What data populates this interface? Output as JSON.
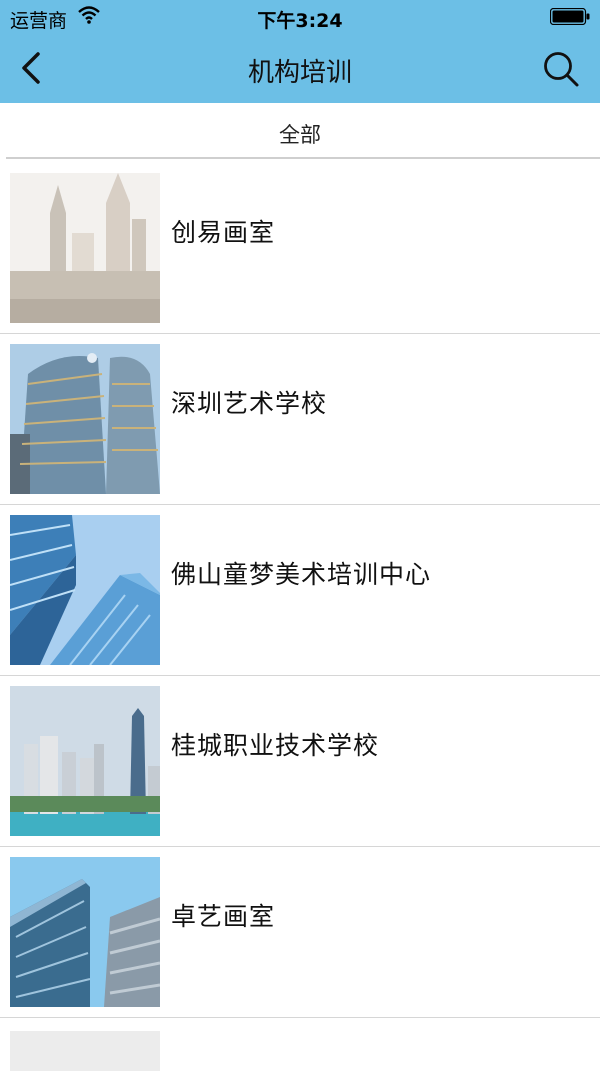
{
  "status": {
    "carrier": "运营商",
    "time": "下午3:24"
  },
  "nav": {
    "title": "机构培训",
    "back_icon": "chevron-left-icon",
    "search_icon": "search-icon"
  },
  "filter": {
    "label": "全部"
  },
  "items": [
    {
      "name": "创易画室",
      "thumb": "building-photo"
    },
    {
      "name": "深圳艺术学校",
      "thumb": "building-photo"
    },
    {
      "name": "佛山童梦美术培训中心",
      "thumb": "building-photo"
    },
    {
      "name": "桂城职业技术学校",
      "thumb": "building-photo"
    },
    {
      "name": "卓艺画室",
      "thumb": "building-photo"
    }
  ],
  "colors": {
    "header": "#6cbfe6",
    "divider": "#d6d6d6"
  }
}
